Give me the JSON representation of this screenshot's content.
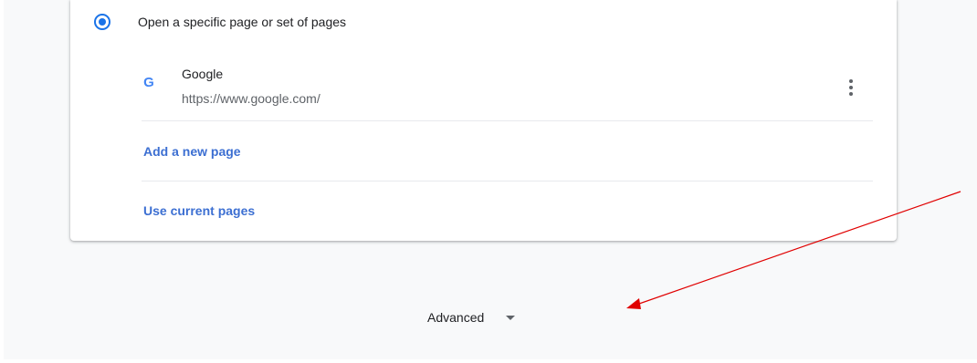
{
  "startup": {
    "radio_label": "Open a specific page or set of pages",
    "radio_selected": true
  },
  "site": {
    "icon": "google-g-icon",
    "name": "Google",
    "url": "https://www.google.com/",
    "more_icon": "more-vert-icon"
  },
  "links": {
    "add_page": "Add a new page",
    "use_current": "Use current pages"
  },
  "advanced": {
    "label": "Advanced",
    "icon": "caret-down-icon"
  },
  "colors": {
    "accent": "#1a73e8",
    "link": "#3c6fd2",
    "annotation_arrow": "#e00000"
  }
}
